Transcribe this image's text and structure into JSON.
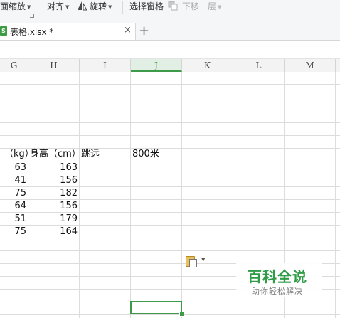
{
  "ribbon": {
    "page_zoom": "面缩放",
    "align": "对齐",
    "rotate": "旋转",
    "selection_pane": "选择窗格",
    "send_backward": "下移一层"
  },
  "tab": {
    "filename": "表格.xlsx *",
    "file_icon": "spreadsheet-file-icon",
    "close": "×",
    "new_tab": "+"
  },
  "columns": [
    "G",
    "H",
    "I",
    "J",
    "K",
    "L",
    "M"
  ],
  "selected_column": "J",
  "rows": [
    {
      "g": "（kg）",
      "h": "身高（cm）",
      "i": "跳远",
      "j": "800米"
    },
    {
      "g": "63",
      "h": "163"
    },
    {
      "g": "41",
      "h": "156"
    },
    {
      "g": "75",
      "h": "182"
    },
    {
      "g": "64",
      "h": "156"
    },
    {
      "g": "51",
      "h": "179"
    },
    {
      "g": "75",
      "h": "164"
    }
  ],
  "paste_options_icon": "paste-options-icon",
  "watermark": {
    "title": "百科全说",
    "subtitle": "助你轻松解决"
  },
  "colors": {
    "accent": "#3d9b4a",
    "grid": "#dcdcdc"
  }
}
